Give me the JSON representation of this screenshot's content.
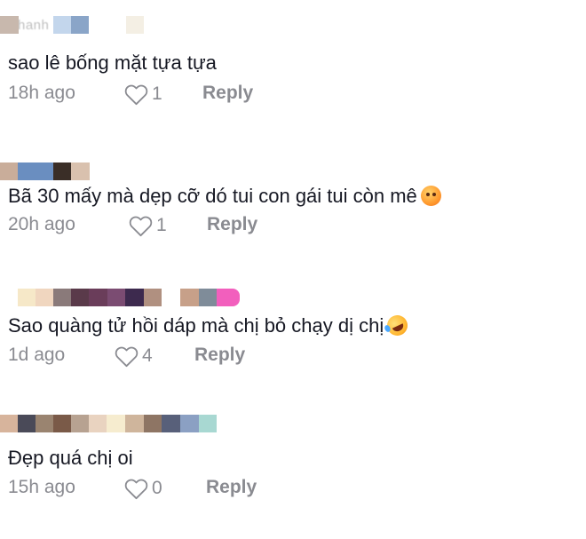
{
  "comments": [
    {
      "author_obscured": "hanh Nhan",
      "text": "sao lê bống mặt tựa tựa",
      "time": "18h ago",
      "likes": "1",
      "reply_label": "Reply",
      "emoji": ""
    },
    {
      "author_obscured": "",
      "text": "Bã 30 mấy mà dẹp cỡ dó tui con gái tui còn mê",
      "time": "20h ago",
      "likes": "1",
      "reply_label": "Reply",
      "emoji": "smiling-face-with-hearts"
    },
    {
      "author_obscured": "",
      "text": "Sao quàng tử hồi dáp mà chị bỏ chạy dị chị",
      "time": "1d ago",
      "likes": "4",
      "reply_label": "Reply",
      "emoji": "rolling-on-floor-laughing"
    },
    {
      "author_obscured": "",
      "text": "Đẹp quá chị oi",
      "time": "15h ago",
      "likes": "0",
      "reply_label": "Reply",
      "emoji": ""
    }
  ],
  "colors": {
    "text": "#161823",
    "muted": "#8a8b91",
    "background": "#ffffff"
  },
  "icons": {
    "like": "heart-outline-icon"
  }
}
